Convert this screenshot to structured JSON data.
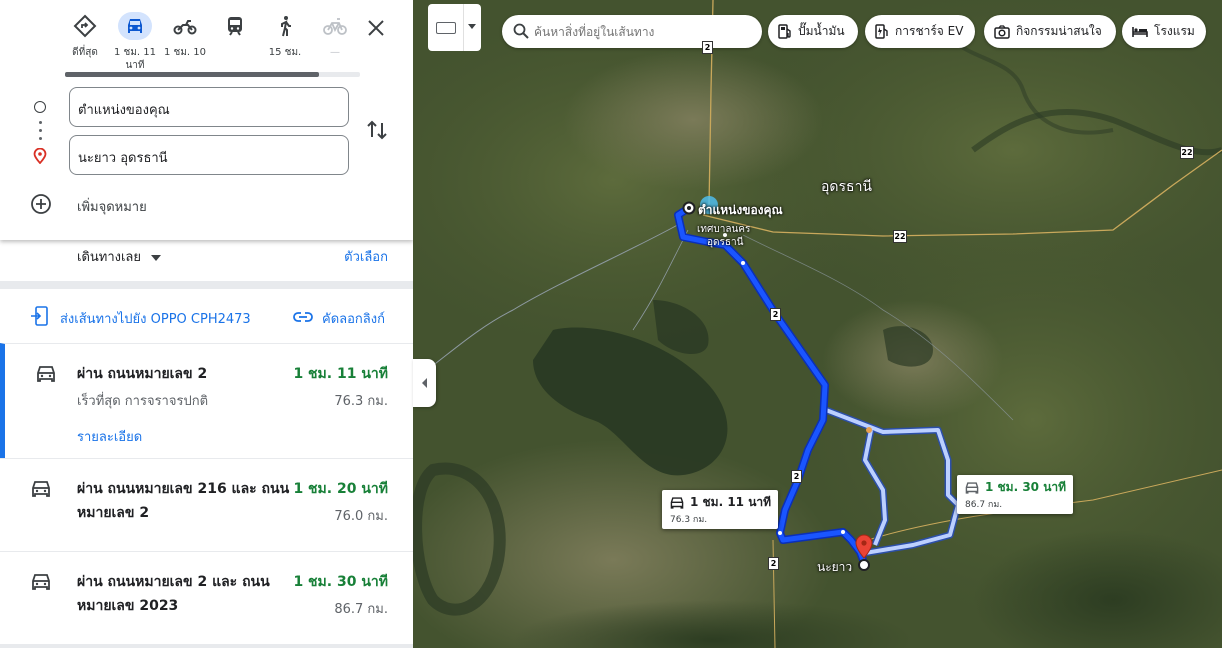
{
  "modes": [
    {
      "name": "best",
      "label": "ดีที่สุด",
      "icon": "best-route-icon",
      "active": false
    },
    {
      "name": "car",
      "label": "1 ชม. 11 นาที",
      "icon": "car-icon",
      "active": true
    },
    {
      "name": "motorbike",
      "label": "1 ชม. 10",
      "icon": "motorbike-icon",
      "active": false
    },
    {
      "name": "transit",
      "label": "",
      "icon": "train-icon",
      "active": false
    },
    {
      "name": "walk",
      "label": "15 ชม.",
      "icon": "walk-icon",
      "active": false
    },
    {
      "name": "bike",
      "label": "—",
      "icon": "bicycle-icon",
      "active": false
    }
  ],
  "mode_progress": 0.86,
  "origin": {
    "value": "ตำแหน่งของคุณ"
  },
  "destination": {
    "value": "นะยาว อุดรธานี"
  },
  "add_destination": "เพิ่มจุดหมาย",
  "depart_now": "เดินทางเลย",
  "options": "ตัวเลือก",
  "send_to_device": "ส่งเส้นทางไปยัง OPPO CPH2473",
  "copy_link": "คัดลอกลิงก์",
  "routes": [
    {
      "name": "ผ่าน ถนนหมายเลข 2",
      "time": "1 ชม. 11 นาที",
      "distance": "76.3 กม.",
      "sub": "เร็วที่สุด การจราจรปกติ",
      "details": "รายละเอียด"
    },
    {
      "name": "ผ่าน ถนนหมายเลข 216 และ ถนนหมายเลข 2",
      "time": "1 ชม. 20 นาที",
      "distance": "76.0 กม."
    },
    {
      "name": "ผ่าน ถนนหมายเลข 2 และ ถนนหมายเลข 2023",
      "time": "1 ชม. 30 นาที",
      "distance": "86.7 กม."
    }
  ],
  "map": {
    "search_placeholder": "ค้นหาสิ่งที่อยู่ในเส้นทาง",
    "chips": {
      "gas": "ปั๊มน้ำมัน",
      "ev": "การชาร์จ EV",
      "attractions": "กิจกรรมน่าสนใจ",
      "hotels": "โรงแรม"
    },
    "labels": {
      "province": "อุดรธานี",
      "origin": "ตำแหน่งของคุณ",
      "municipality_1": "เทศบาลนคร",
      "municipality_2": "อุดรธานี",
      "destination": "นะยาว"
    },
    "callouts": {
      "main": {
        "time": "1 ชม. 11 นาที",
        "distance": "76.3 กม."
      },
      "alt": {
        "time": "1 ชม. 30 นาที",
        "distance": "86.7 กม."
      }
    },
    "shields": [
      "2",
      "22",
      "22",
      "2",
      "2",
      "2"
    ]
  },
  "colors": {
    "accent": "#1a73e8",
    "green": "#188038",
    "route": "#1a55ff",
    "alt_route": "#bcd0ff"
  }
}
